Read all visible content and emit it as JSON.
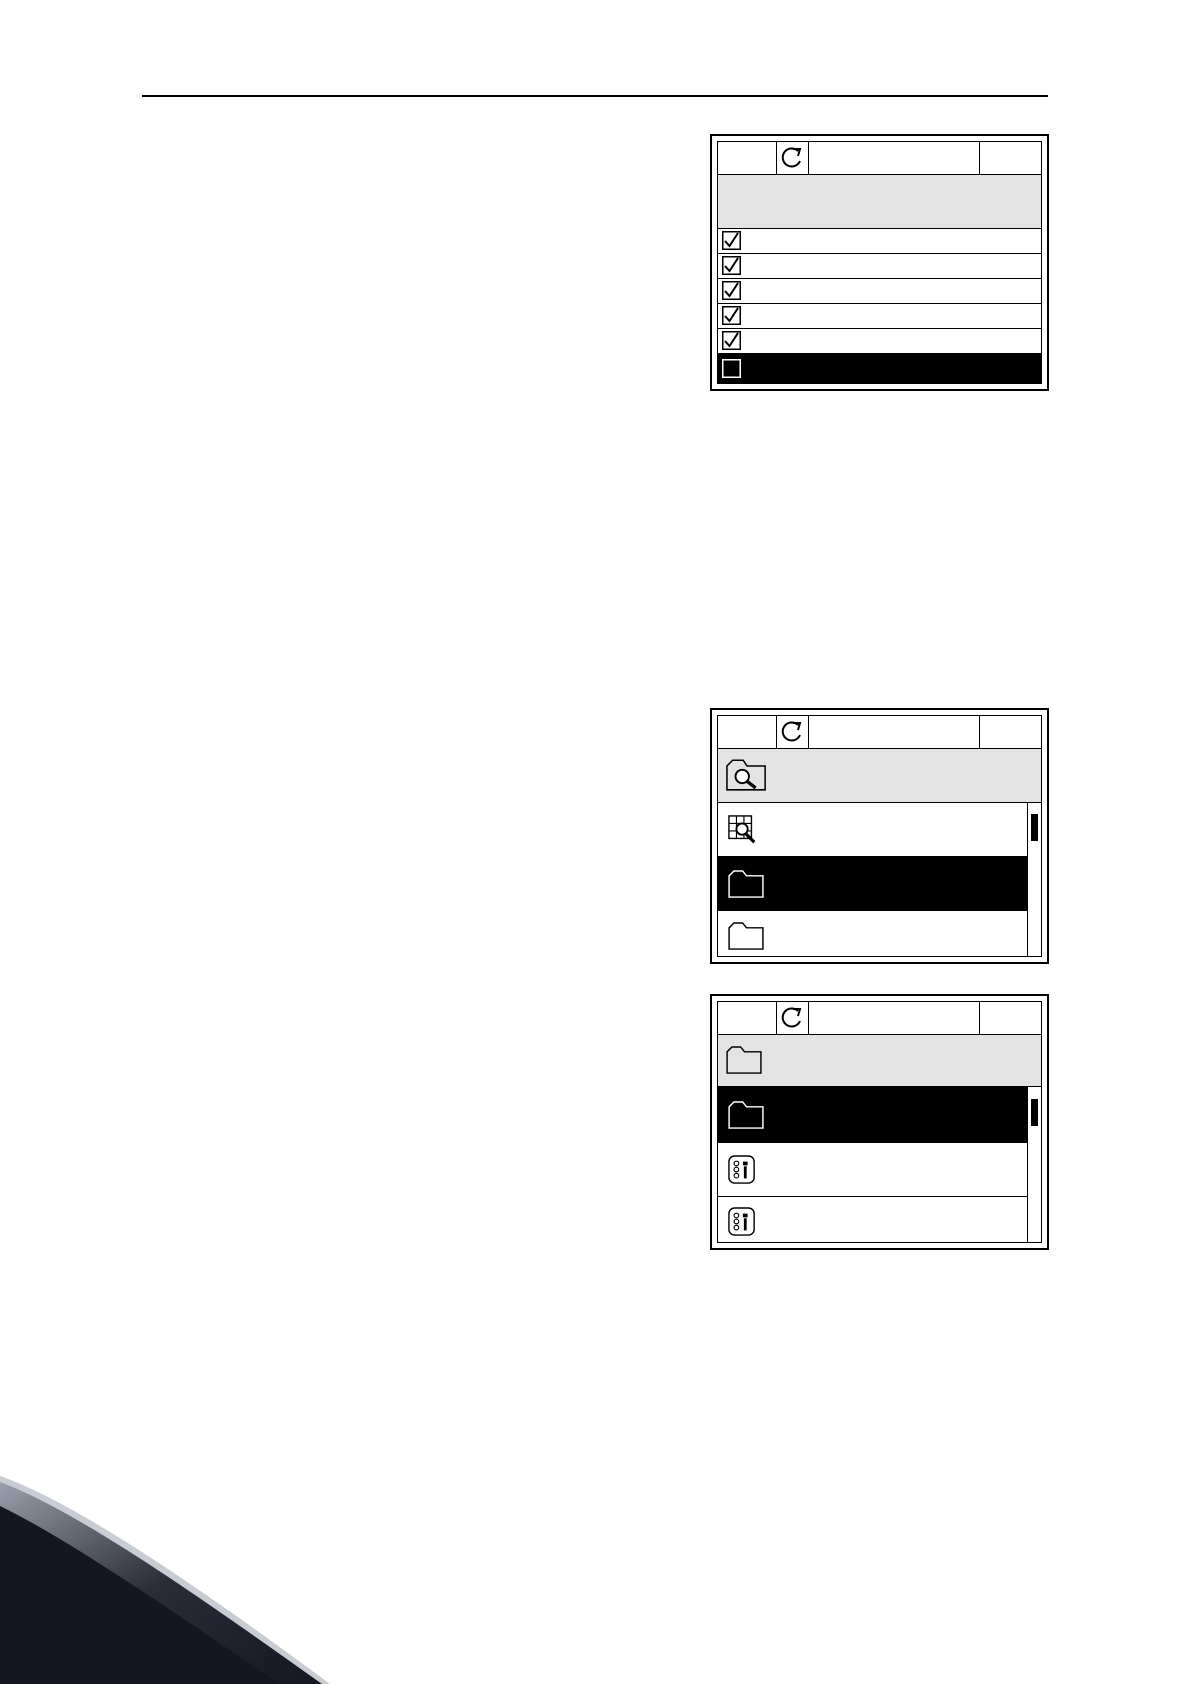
{
  "page": {
    "background": "#ffffff",
    "text_color": "#000000"
  },
  "panel_1": {
    "title": "",
    "status_icon": "loop-arrow-icon",
    "items": [
      {
        "label": "",
        "checked": true,
        "selected": false
      },
      {
        "label": "",
        "checked": true,
        "selected": false
      },
      {
        "label": "",
        "checked": true,
        "selected": false
      },
      {
        "label": "",
        "checked": true,
        "selected": false
      },
      {
        "label": "",
        "checked": true,
        "selected": false
      },
      {
        "label": "",
        "checked": false,
        "selected": true
      }
    ]
  },
  "panel_2": {
    "title": "",
    "title_icon": "folder-search-icon",
    "status_icon": "loop-arrow-icon",
    "items": [
      {
        "label": "",
        "icon": "grid-search-icon",
        "selected": false
      },
      {
        "label": "",
        "icon": "folder-icon",
        "selected": true
      },
      {
        "label": "",
        "icon": "folder-icon",
        "selected": false
      }
    ],
    "scrollbar_position": 0.1
  },
  "panel_3": {
    "title": "",
    "title_icon": "folder-icon",
    "status_icon": "loop-arrow-icon",
    "items": [
      {
        "label": "",
        "icon": "folder-icon",
        "selected": true
      },
      {
        "label": "",
        "icon": "parameter-icon",
        "selected": false
      },
      {
        "label": "",
        "icon": "parameter-icon",
        "selected": false
      }
    ],
    "scrollbar_position": 0.1
  },
  "colors": {
    "title_bar": "#e3e3e3",
    "selected_row": "#000000",
    "swoosh": "#141621"
  }
}
